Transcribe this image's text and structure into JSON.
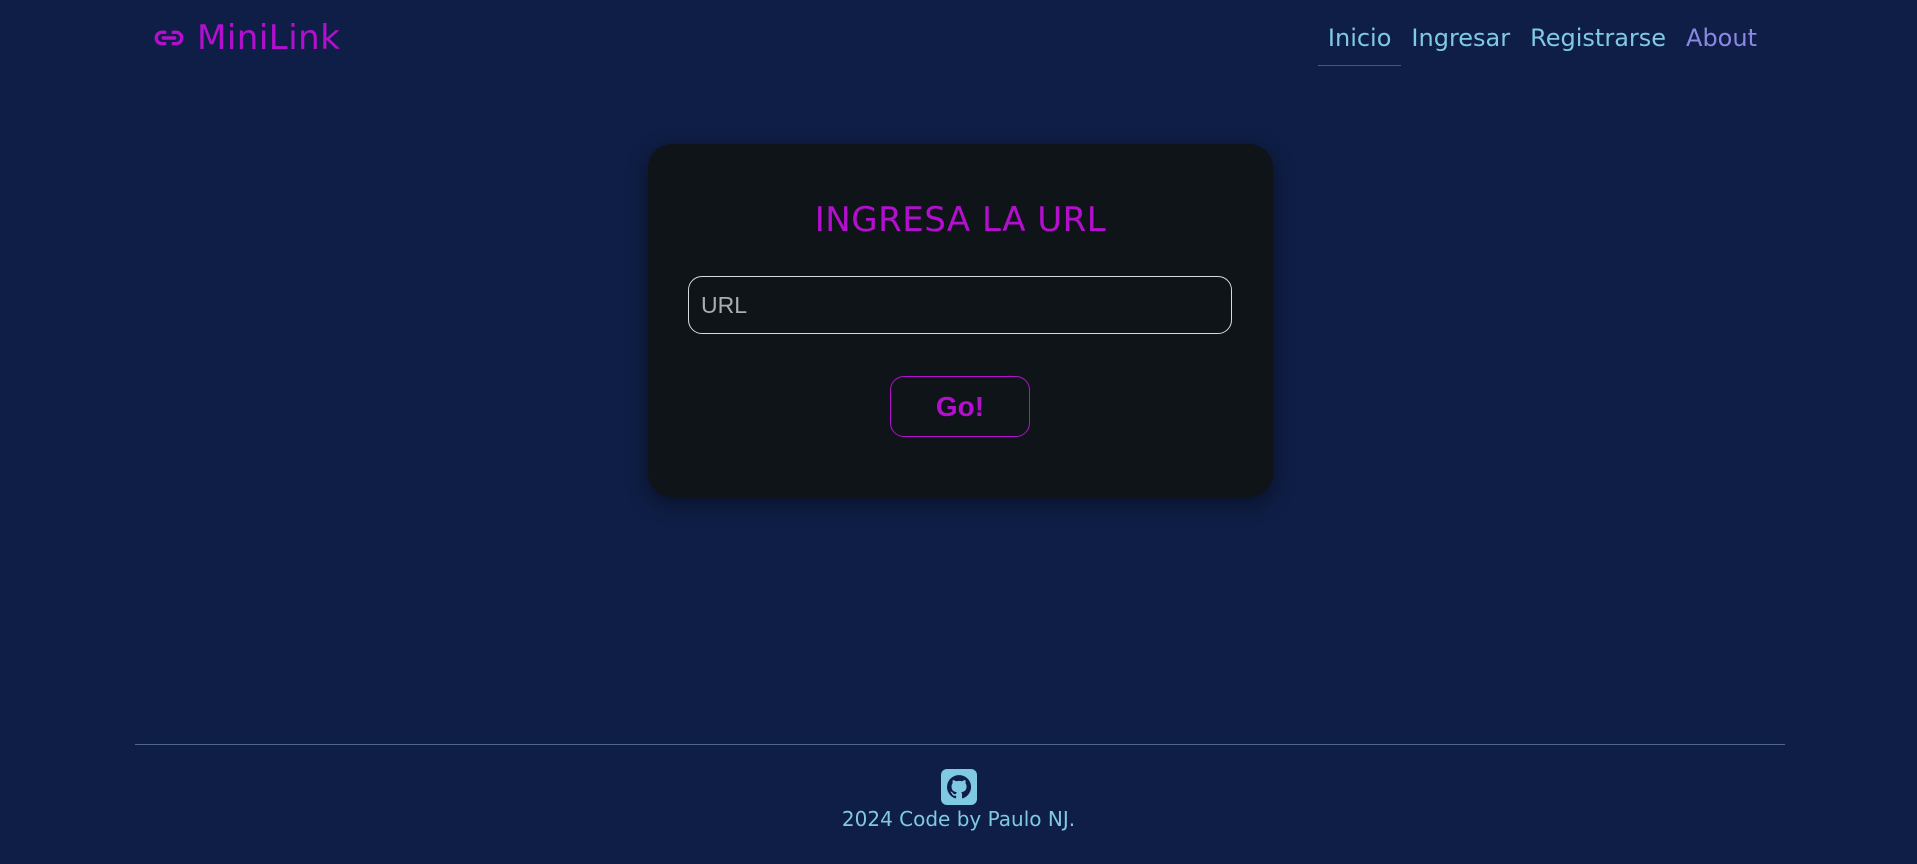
{
  "header": {
    "brand": {
      "icon": "link-icon",
      "name": "MiniLink"
    },
    "nav": [
      {
        "label": "Inicio",
        "active": true
      },
      {
        "label": "Ingresar",
        "active": false
      },
      {
        "label": "Registrarse",
        "active": false
      },
      {
        "label": "About",
        "active": false
      }
    ]
  },
  "card": {
    "title": "INGRESA LA URL",
    "url_input": {
      "placeholder": "URL",
      "value": ""
    },
    "go_label": "Go!"
  },
  "footer": {
    "icon": "github-icon",
    "credit": "2024 Code by Paulo NJ."
  },
  "colors": {
    "background": "#0f1e46",
    "accent": "#b40fcf",
    "link": "#7fc9e3",
    "muted_link": "#8d86e3",
    "card": "#0f1419"
  }
}
